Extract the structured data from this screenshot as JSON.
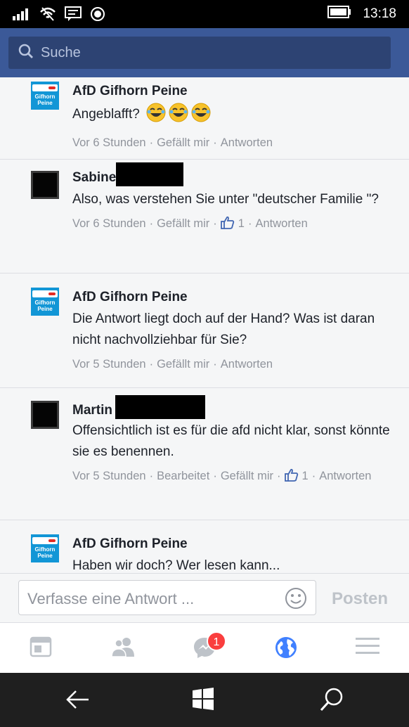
{
  "status_bar": {
    "time": "13:18",
    "icons": [
      "signal-icon",
      "wifi-icon",
      "message-icon",
      "record-icon",
      "battery-icon"
    ]
  },
  "search": {
    "label": "Suche"
  },
  "comments": [
    {
      "author": "AfD Gifhorn Peine",
      "avatar": "afd-logo",
      "text": "Angeblafft?",
      "emojis": [
        "laughing-emoji",
        "laughing-emoji",
        "laughing-emoji"
      ],
      "time": "Vor 6 Stunden",
      "like_label": "Gefällt mir",
      "reply_label": "Antworten"
    },
    {
      "author": "Sabine",
      "avatar": "dark-avatar",
      "text": "Also, was verstehen Sie unter \"deutscher Familie \"?",
      "time": "Vor 6 Stunden",
      "like_label": "Gefällt mir",
      "like_count": "1",
      "reply_label": "Antworten"
    },
    {
      "author": "AfD Gifhorn Peine",
      "avatar": "afd-logo",
      "text": "Die Antwort liegt doch auf der Hand? Was ist daran nicht nachvollziehbar für Sie?",
      "time": "Vor 5 Stunden",
      "like_label": "Gefällt mir",
      "reply_label": "Antworten"
    },
    {
      "author": "Martin",
      "avatar": "dark-avatar",
      "text": "Offensichtlich ist es für die afd nicht klar, sonst könnte sie es benennen.",
      "time": "Vor 5 Stunden",
      "edited_label": "Bearbeitet",
      "like_label": "Gefällt mir",
      "like_count": "1",
      "reply_label": "Antworten"
    },
    {
      "author": "AfD Gifhorn Peine",
      "avatar": "afd-logo",
      "text": "Haben wir doch? Wer lesen kann...",
      "time": "",
      "like_label": "",
      "reply_label": ""
    }
  ],
  "afd_logo_text": [
    "Gifhorn",
    "Peine"
  ],
  "composer": {
    "placeholder": "Verfasse eine Antwort ...",
    "post_label": "Posten"
  },
  "fb_nav": {
    "items": [
      "news-feed-icon",
      "friends-icon",
      "messenger-icon",
      "notifications-globe-icon",
      "menu-icon"
    ],
    "messenger_badge": "1",
    "active": "notifications-globe-icon"
  },
  "win_nav": {
    "items": [
      "back-icon",
      "windows-start-icon",
      "search-icon"
    ]
  },
  "colors": {
    "header": "#3b5998",
    "search_box": "#2d4373",
    "active_nav": "#4080ff",
    "badge": "#fa3e3e",
    "afd_blue": "#1296d6"
  }
}
